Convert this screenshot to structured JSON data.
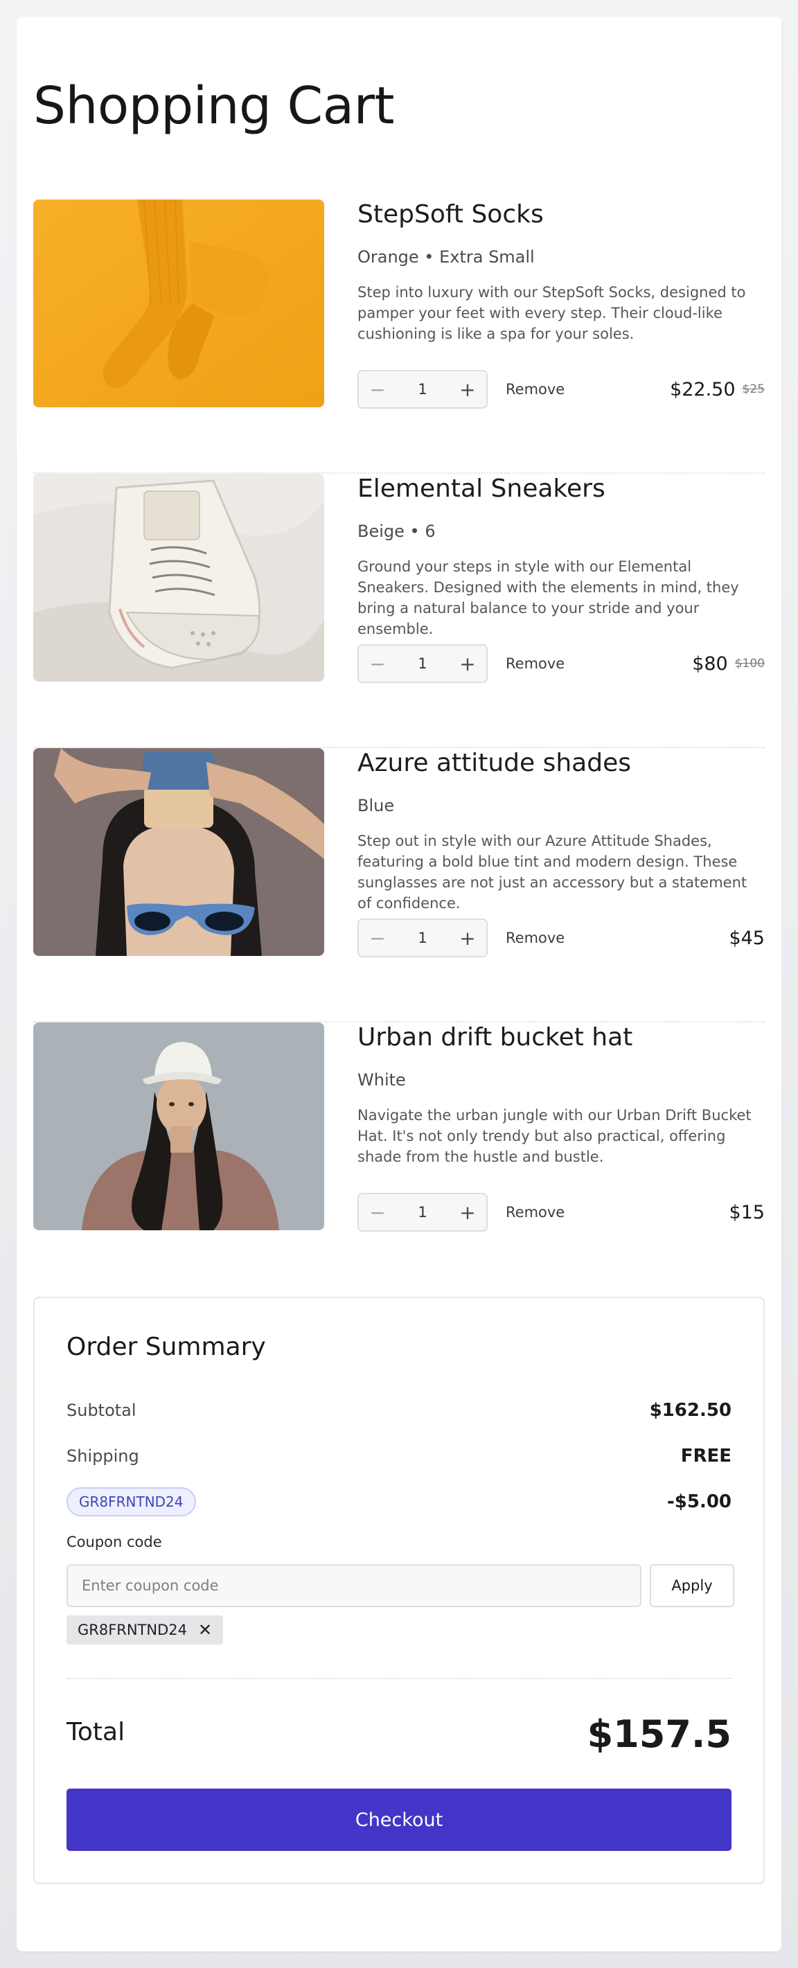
{
  "page": {
    "title": "Shopping Cart"
  },
  "cart": {
    "items": [
      {
        "name": "StepSoft Socks",
        "variant": "Orange • Extra Small",
        "description": "Step into luxury with our StepSoft Socks, designed to pamper your feet with every step. Their cloud-like cushioning is like a spa for your soles.",
        "quantity": "1",
        "price": "$22.50",
        "old_price": "$25",
        "image": "orange-socks"
      },
      {
        "name": "Elemental Sneakers",
        "variant": "Beige • 6",
        "description": "Ground your steps in style with our Elemental Sneakers. Designed with the elements in mind, they bring a natural balance to your stride and your ensemble.",
        "quantity": "1",
        "price": "$80",
        "old_price": "$100",
        "image": "white-sneaker"
      },
      {
        "name": "Azure attitude shades",
        "variant": "Blue",
        "description": "Step out in style with our Azure Attitude Shades, featuring a bold blue tint and modern design. These sunglasses are not just an accessory but a statement of confidence.",
        "quantity": "1",
        "price": "$45",
        "image": "blue-sunglasses"
      },
      {
        "name": "Urban drift bucket hat",
        "variant": "White",
        "description": "Navigate the urban jungle with our Urban Drift Bucket Hat. It's not only trendy but also practical, offering shade from the hustle and bustle.",
        "quantity": "1",
        "price": "$15",
        "image": "white-bucket-hat"
      }
    ],
    "remove_label": "Remove",
    "minus_icon": "minus-icon",
    "plus_icon": "plus-icon"
  },
  "summary": {
    "title": "Order Summary",
    "subtotal_label": "Subtotal",
    "subtotal_value": "$162.50",
    "shipping_label": "Shipping",
    "shipping_value": "FREE",
    "discount_code": "GR8FRNTND24",
    "discount_value": "-$5.00",
    "coupon_label": "Coupon code",
    "coupon_placeholder": "Enter coupon code",
    "apply_label": "Apply",
    "applied_coupon": "GR8FRNTND24",
    "total_label": "Total",
    "total_value": "$157.5",
    "checkout_label": "Checkout"
  },
  "colors": {
    "accent": "#4335c7",
    "badge_bg": "#eef0ff",
    "badge_text": "#3f45b8"
  }
}
